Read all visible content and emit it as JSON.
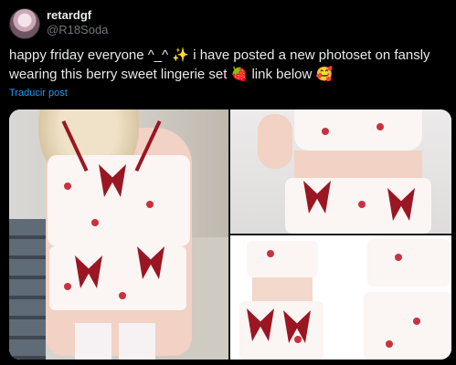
{
  "user": {
    "display_name": "retardgf",
    "handle": "@R18Soda",
    "avatar_icon": "avatar-icon"
  },
  "tweet": {
    "text_part1": "happy friday everyone ^_^ ",
    "emoji_sparkles": "✨",
    "text_part2": " i have posted a new photoset on fansly wearing this berry sweet lingerie set ",
    "emoji_strawberry": "🍓",
    "text_part3": "link below ",
    "emoji_smile": "🥰",
    "translate_label": "Traducir post"
  },
  "colors": {
    "background": "#000000",
    "text": "#e7e9ea",
    "muted": "#71767b",
    "link": "#1d9bf0",
    "accent_red": "#9a1622"
  }
}
